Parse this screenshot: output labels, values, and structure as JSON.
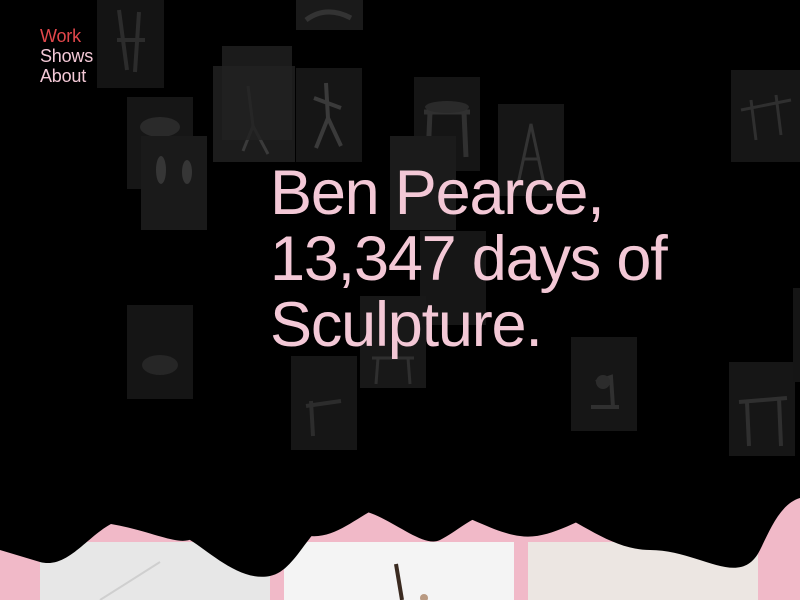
{
  "nav": {
    "items": [
      {
        "label": "Work",
        "active": true
      },
      {
        "label": "Shows",
        "active": false
      },
      {
        "label": "About",
        "active": false
      }
    ]
  },
  "hero": {
    "line1": "Ben Pearce,",
    "line2": "13,347 days of",
    "line3": "Sculpture."
  },
  "colors": {
    "background": "#000000",
    "text_pink": "#f3c8d6",
    "active_red": "#e2474b",
    "band_pink": "#f1b9c8"
  }
}
